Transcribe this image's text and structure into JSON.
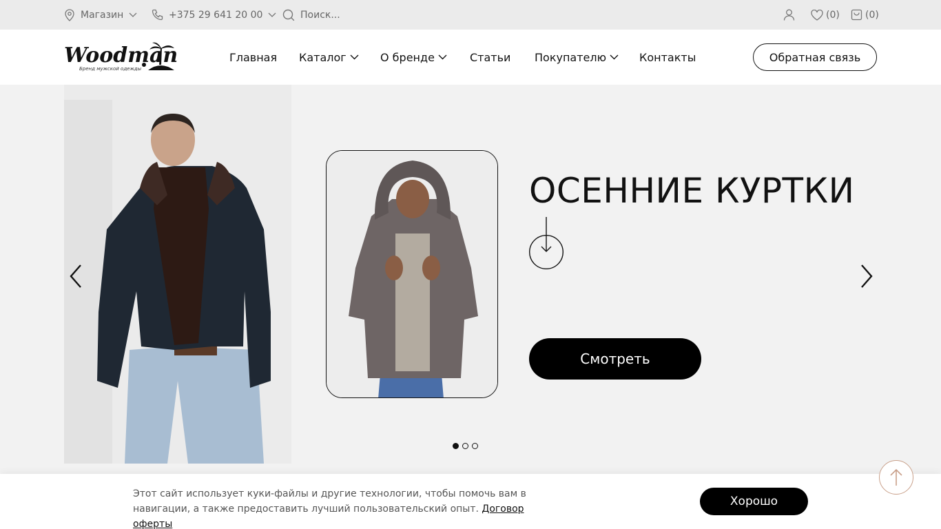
{
  "topbar": {
    "store_label": "Магазин",
    "phone": "+375 29 641 20 00",
    "search_placeholder": "Поиск...",
    "favorites_count": "(0)",
    "cart_count": "(0)"
  },
  "header": {
    "logo_text": "Woodman",
    "logo_tagline": "Бренд мужской одежды",
    "nav": {
      "home": "Главная",
      "catalog": "Каталог",
      "brand": "О бренде",
      "articles": "Статьи",
      "buyer": "Покупателю",
      "contacts": "Контакты"
    },
    "feedback_label": "Обратная связь"
  },
  "hero": {
    "title": "ОСЕННИЕ КУРТКИ",
    "button_label": "Смотреть",
    "slides_total": 3,
    "active_slide": 1
  },
  "cookie": {
    "text": "Этот сайт использует куки-файлы и другие технологии, чтобы помочь вам в навигации, а также предоставить лучший пользовательский опыт.",
    "link_label": "Договор оферты",
    "ok_label": "Хорошо"
  },
  "colors": {
    "topbar_bg": "#ebebeb",
    "hero_bg": "#f2f2f2",
    "button_bg": "#000000",
    "scroll_top_border": "#c9a08a"
  }
}
